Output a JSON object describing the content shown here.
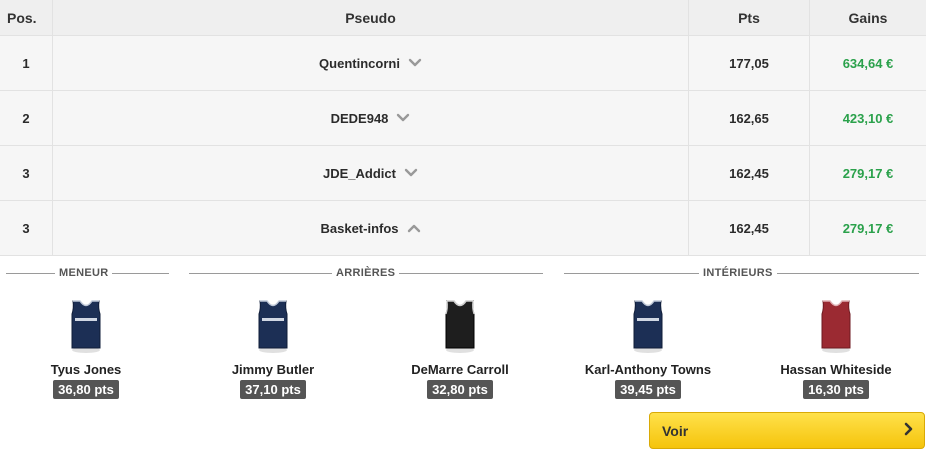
{
  "table": {
    "headers": {
      "pos": "Pos.",
      "pseudo": "Pseudo",
      "pts": "Pts",
      "gains": "Gains"
    },
    "rows": [
      {
        "pos": "1",
        "pseudo": "Quentincorni",
        "pts": "177,05",
        "gains": "634,64 €",
        "toggle": "chevron-down-icon"
      },
      {
        "pos": "2",
        "pseudo": "DEDE948",
        "pts": "162,65",
        "gains": "423,10 €",
        "toggle": "chevron-down-icon"
      },
      {
        "pos": "3",
        "pseudo": "JDE_Addict",
        "pts": "162,45",
        "gains": "279,17 €",
        "toggle": "chevron-down-icon"
      },
      {
        "pos": "3",
        "pseudo": "Basket-infos",
        "pts": "162,45",
        "gains": "279,17 €",
        "toggle": "chevron-up-icon"
      }
    ]
  },
  "lineup": {
    "groups": {
      "meneur": "MENEUR",
      "arrieres": "ARRIÈRES",
      "interieurs": "INTÉRIEURS"
    },
    "players": [
      {
        "name": "Tyus Jones",
        "pts": "36,80 pts",
        "jersey": "navy"
      },
      {
        "name": "Jimmy Butler",
        "pts": "37,10 pts",
        "jersey": "navy"
      },
      {
        "name": "DeMarre Carroll",
        "pts": "32,80 pts",
        "jersey": "black"
      },
      {
        "name": "Karl-Anthony Towns",
        "pts": "39,45 pts",
        "jersey": "navy"
      },
      {
        "name": "Hassan Whiteside",
        "pts": "16,30 pts",
        "jersey": "red"
      }
    ]
  },
  "button": {
    "label": "Voir",
    "icon": "chevron-right-icon"
  },
  "colors": {
    "gain": "#2aa14b",
    "navy": "#1c2f55",
    "black": "#1e1e1e",
    "red": "#9b2a32",
    "button": "#f7c912"
  }
}
